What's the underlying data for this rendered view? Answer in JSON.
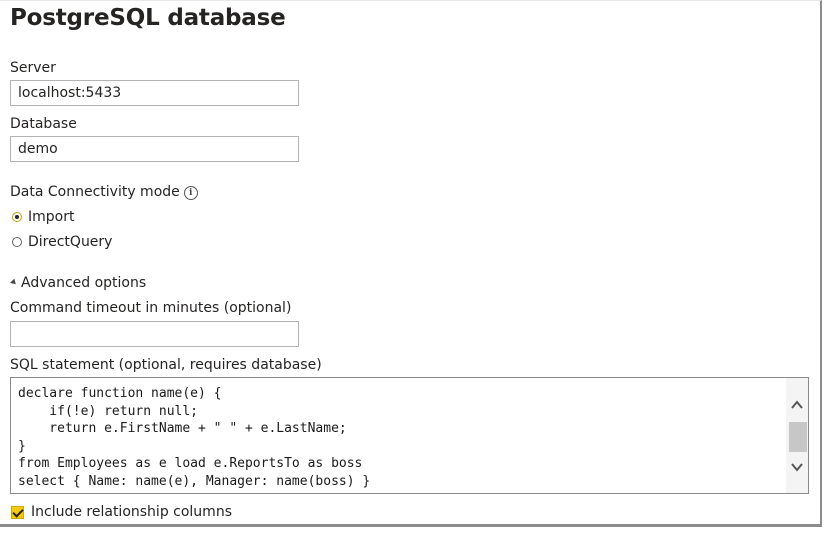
{
  "dialog": {
    "title": "PostgreSQL database"
  },
  "server": {
    "label": "Server",
    "value": "localhost:5433"
  },
  "database": {
    "label": "Database",
    "value": "demo"
  },
  "connectivity": {
    "label": "Data Connectivity mode",
    "info_icon": "i",
    "options": [
      {
        "label": "Import",
        "selected": true
      },
      {
        "label": "DirectQuery",
        "selected": false
      }
    ]
  },
  "advanced": {
    "label": "Advanced options",
    "timeout_label": "Command timeout in minutes (optional)",
    "timeout_value": "",
    "sql_label": "SQL statement (optional, requires database)",
    "sql_value": "declare function name(e) {\n    if(!e) return null;\n    return e.FirstName + \" \" + e.LastName;\n}\nfrom Employees as e load e.ReportsTo as boss\nselect { Name: name(e), Manager: name(boss) }",
    "include_relationship_label": "Include relationship columns",
    "include_relationship_checked": true
  },
  "colors": {
    "accent": "#f2c811",
    "text": "#252423",
    "border": "#b3b3b3"
  }
}
